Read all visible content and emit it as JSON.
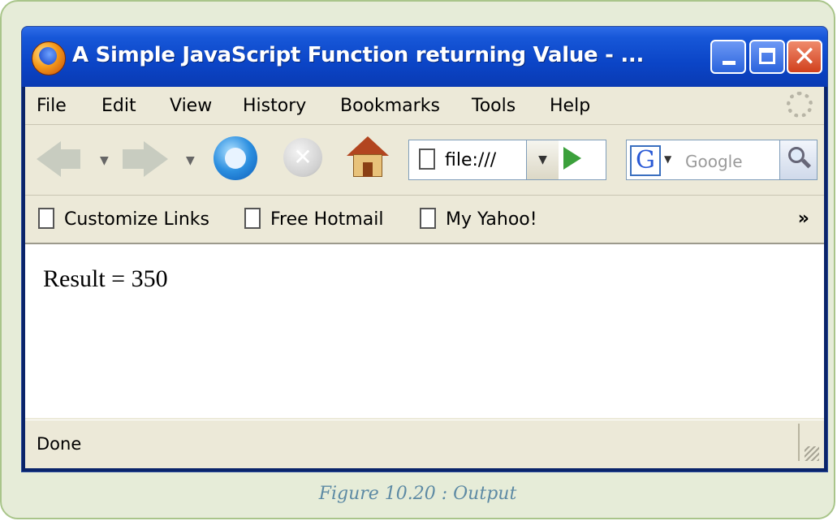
{
  "window": {
    "title": "A Simple JavaScript Function returning Value - ..."
  },
  "menu": {
    "items": [
      "File",
      "Edit",
      "View",
      "History",
      "Bookmarks",
      "Tools",
      "Help"
    ]
  },
  "toolbar": {
    "url": "file:///",
    "search_placeholder": "Google"
  },
  "bookmarks": {
    "items": [
      "Customize Links",
      "Free Hotmail",
      "My Yahoo!"
    ],
    "overflow": "»"
  },
  "content": {
    "result": "Result = 350"
  },
  "status": {
    "text": "Done"
  },
  "caption": "Figure 10.20 : Output",
  "icons": {
    "app": "firefox-icon",
    "back": "back-arrow-icon",
    "forward": "forward-arrow-icon",
    "reload": "reload-icon",
    "stop": "stop-icon",
    "home": "home-icon",
    "go": "go-arrow-icon",
    "search_engine": "google-g-icon",
    "search": "magnifier-icon"
  },
  "colors": {
    "titlebar": "#0b45c7",
    "chrome": "#ece9d8",
    "caption": "#5d8aa4",
    "frame_border": "#a9c58a"
  }
}
